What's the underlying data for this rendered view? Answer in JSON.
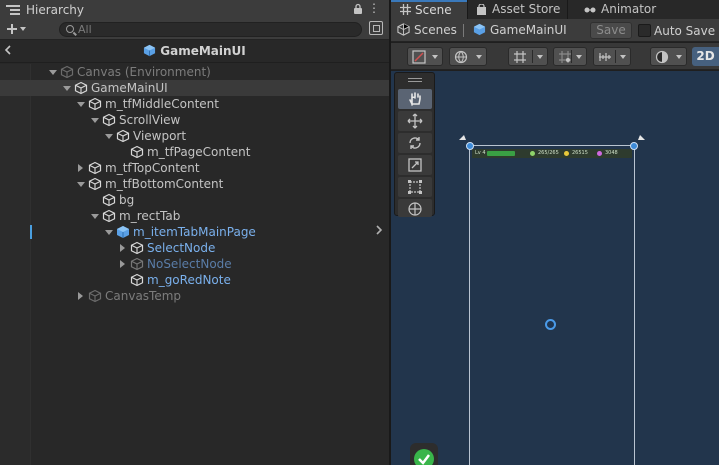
{
  "hierarchy": {
    "tab_label": "Hierarchy",
    "search_placeholder": "All",
    "breadcrumb": "GameMainUI",
    "tree": [
      {
        "label": "Canvas (Environment)",
        "depth": 0,
        "fold": "open",
        "icon": "cube-gray-icon",
        "style": "dim",
        "selected": false
      },
      {
        "label": "GameMainUI",
        "depth": 1,
        "fold": "open",
        "icon": "cube-outline-icon",
        "style": "normal",
        "selected": true
      },
      {
        "label": "m_tfMiddleContent",
        "depth": 2,
        "fold": "open",
        "icon": "cube-outline-icon",
        "style": "normal",
        "selected": false
      },
      {
        "label": "ScrollView",
        "depth": 3,
        "fold": "open",
        "icon": "cube-outline-icon",
        "style": "normal",
        "selected": false
      },
      {
        "label": "Viewport",
        "depth": 4,
        "fold": "open",
        "icon": "cube-outline-icon",
        "style": "normal",
        "selected": false
      },
      {
        "label": "m_tfPageContent",
        "depth": 5,
        "fold": "none",
        "icon": "cube-outline-icon",
        "style": "normal",
        "selected": false
      },
      {
        "label": "m_tfTopContent",
        "depth": 2,
        "fold": "closed",
        "icon": "cube-outline-icon",
        "style": "normal",
        "selected": false
      },
      {
        "label": "m_tfBottomContent",
        "depth": 2,
        "fold": "open",
        "icon": "cube-outline-icon",
        "style": "normal",
        "selected": false
      },
      {
        "label": "bg",
        "depth": 3,
        "fold": "none",
        "icon": "cube-outline-icon",
        "style": "normal",
        "selected": false
      },
      {
        "label": "m_rectTab",
        "depth": 3,
        "fold": "open",
        "icon": "cube-outline-icon",
        "style": "normal",
        "selected": false
      },
      {
        "label": "m_itemTabMainPage",
        "depth": 4,
        "fold": "open",
        "icon": "prefab-cube-icon",
        "style": "prefab",
        "selected": false,
        "marked": true,
        "arrow": true
      },
      {
        "label": "SelectNode",
        "depth": 5,
        "fold": "closed",
        "icon": "prefab-outline-icon",
        "style": "prefab",
        "selected": false
      },
      {
        "label": "NoSelectNode",
        "depth": 5,
        "fold": "closed",
        "icon": "prefab-dim-icon",
        "style": "prefab-dim",
        "selected": false
      },
      {
        "label": "m_goRedNote",
        "depth": 5,
        "fold": "none",
        "icon": "prefab-outline-icon",
        "style": "prefab",
        "selected": false
      },
      {
        "label": "CanvasTemp",
        "depth": 2,
        "fold": "closed",
        "icon": "cube-gray-icon",
        "style": "dim",
        "selected": false
      }
    ]
  },
  "scene": {
    "tabs": [
      {
        "label": "Scene",
        "icon": "grid-icon",
        "active": true
      },
      {
        "label": "Asset Store",
        "icon": "store-icon",
        "active": false
      },
      {
        "label": "Animator",
        "icon": "animator-icon",
        "active": false
      }
    ],
    "scenes_label": "Scenes",
    "path_label": "GameMainUI",
    "save_label": "Save",
    "auto_save_label": "Auto Save",
    "auto_save_checked": false,
    "mode_2d_label": "2D",
    "active_tool": "hand-tool",
    "hud": {
      "level": "Lv 4",
      "stat_1": "265/265",
      "stat_2": "26515",
      "stat_3": "3048"
    }
  },
  "colors": {
    "accent": "#3a79bb",
    "prefab_text": "#7ab0ec",
    "viewport_bg": "#22354c",
    "selected_row": "#3a3a3a"
  }
}
